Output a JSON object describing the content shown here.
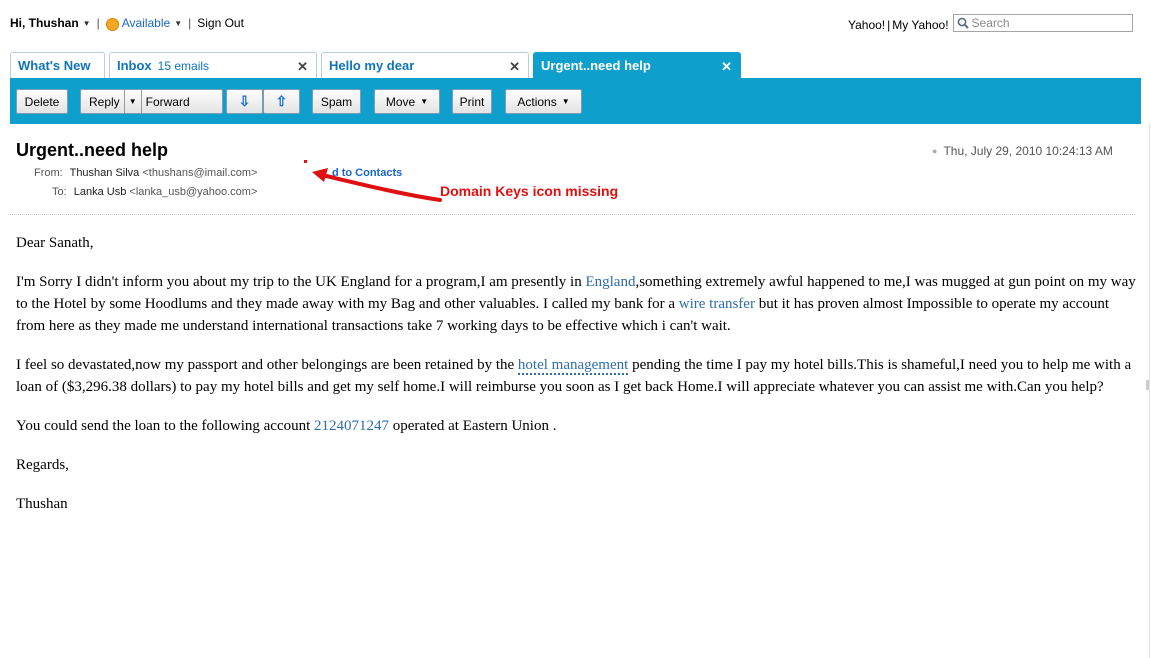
{
  "topbar": {
    "greeting": "Hi, Thushan",
    "status": "Available",
    "sign_out": "Sign Out",
    "yahoo": "Yahoo!",
    "my_yahoo": "My Yahoo!",
    "search_placeholder": "Search"
  },
  "tabs": [
    {
      "label": "What's New"
    },
    {
      "label": "Inbox",
      "count": "15 emails",
      "close": "✕"
    },
    {
      "label": "Hello my dear",
      "close": "✕"
    },
    {
      "label": "Urgent..need help",
      "close": "✕"
    }
  ],
  "toolbar": {
    "delete": "Delete",
    "reply": "Reply",
    "forward": "Forward",
    "spam": "Spam",
    "move": "Move",
    "print": "Print",
    "actions": "Actions"
  },
  "message": {
    "subject": "Urgent..need help",
    "date": "Thu, July 29, 2010 10:24:13 AM",
    "from_label": "From:",
    "from_name": "Thushan Silva",
    "from_email": "<thushans@imail.com>",
    "add_contacts_prefix": "A",
    "add_contacts_suffix": "d to Contacts",
    "to_label": "To:",
    "to_name": "Lanka Usb",
    "to_email": "<lanka_usb@yahoo.com>",
    "annotation": "Domain Keys icon missing",
    "greeting": "Dear Sanath,",
    "p1_a": "I'm Sorry I didn't inform you about my trip to the UK England for a program,I am presently in ",
    "p1_link1": "England",
    "p1_b": ",something extremely awful happened to me,I was mugged at gun point on my way to the Hotel by some Hoodlums and they made away with my Bag and other valuables. I called my bank for a ",
    "p1_link2": "wire transfer",
    "p1_c": " but it has proven almost Impossible to operate my account from here as they made me understand international transactions take 7 working days to be effective which i can't wait.",
    "p2_a": "I feel so devastated,now my passport and other belongings are been retained by the ",
    "p2_link": "hotel management",
    "p2_b": " pending the time I pay my hotel bills.This is shameful,I need you to help me with a loan of ($3,296.38 dollars) to pay my hotel bills and get my self home.I will reimburse you soon as I get back Home.I will appreciate whatever you can assist me with.Can you help?",
    "p3_a": "You could send the loan to the following account ",
    "p3_link": "2124071247",
    "p3_b": " operated at Eastern Union .",
    "regards": "Regards,",
    "signature": "Thushan"
  },
  "colors": {
    "accent": "#0f9fcc",
    "tab_text": "#0f74b8",
    "annotation": "#e01010",
    "link": "#2f6ca8"
  }
}
